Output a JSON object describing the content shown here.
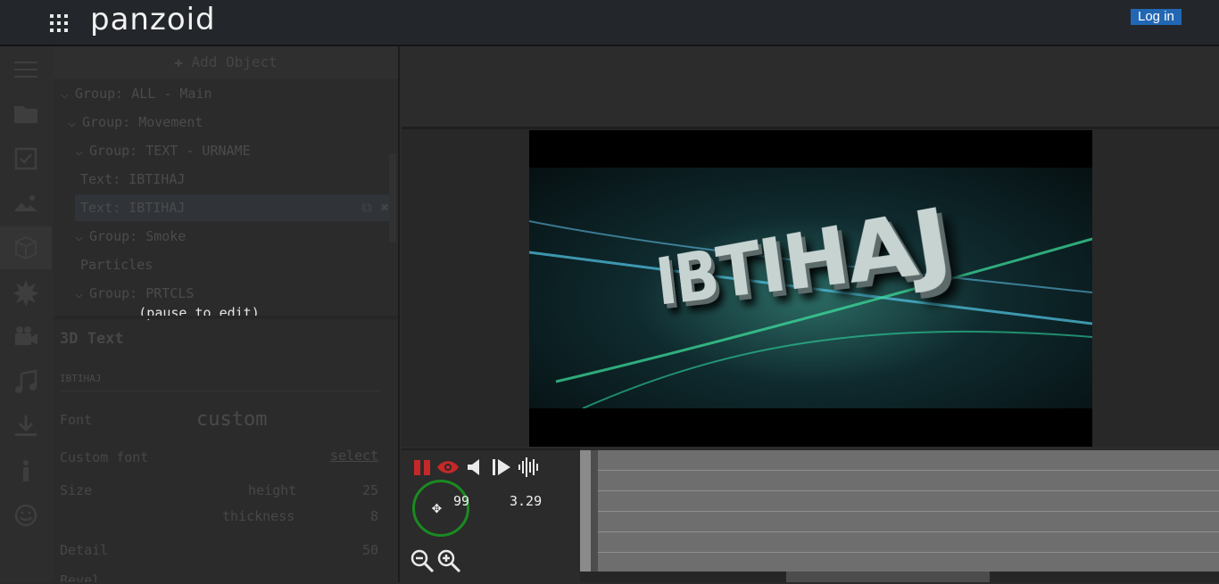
{
  "header": {
    "logo": "panzoid",
    "login_label": "Log in"
  },
  "sidebar": {
    "icons": [
      "menu-icon",
      "folder-icon",
      "checkbox-icon",
      "image-icon",
      "object-3d-icon",
      "burst-icon",
      "camera-icon",
      "music-icon",
      "download-icon",
      "info-icon",
      "smiley-icon"
    ],
    "active_index": 4
  },
  "panel": {
    "add_object_label": "✚ Add Object",
    "tree": [
      {
        "label": "Group: ALL - Main",
        "expanded": true
      },
      {
        "label": "Group: Movement",
        "expanded": true
      },
      {
        "label": "Group: TEXT - URNAME",
        "expanded": true
      },
      {
        "label": "Text: IBTIHAJ"
      },
      {
        "label": "Text: IBTIHAJ",
        "selected": true
      },
      {
        "label": "Group: Smoke",
        "expanded": true
      },
      {
        "label": "Particles"
      },
      {
        "label": "Group: PRTCLS",
        "expanded": true
      }
    ],
    "pause_note": "(pause to edit)"
  },
  "properties": {
    "title": "3D Text",
    "text_value": "IBTIHAJ",
    "font_label": "Font",
    "font_value": "custom",
    "custom_font_label": "Custom font",
    "custom_font_link": "select",
    "size_label": "Size",
    "height_label": "height",
    "height_value": "25",
    "thickness_label": "thickness",
    "thickness_value": "8",
    "detail_label": "Detail",
    "detail_value": "50",
    "next_label": "Bevel"
  },
  "preview": {
    "scene_text": "IBTIHAJ"
  },
  "timeline": {
    "frame_value": "99",
    "time_value": "3.29",
    "accent_color": "#1a8a22",
    "control_color": "#c62828"
  }
}
